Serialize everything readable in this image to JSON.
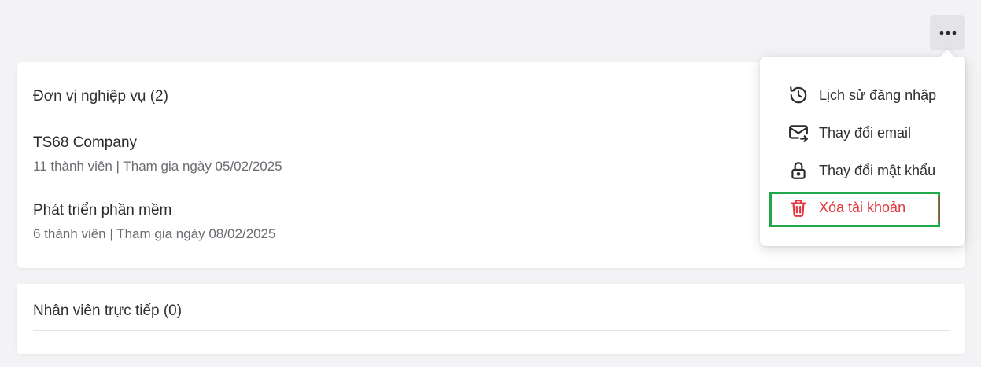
{
  "toolbar": {
    "more_icon": "more-horizontal-icon"
  },
  "units_section": {
    "title": "Đơn vị nghiệp vụ (2)",
    "items": [
      {
        "name": "TS68 Company",
        "meta": "11 thành viên | Tham gia ngày 05/02/2025"
      },
      {
        "name": "Phát triển phần mềm",
        "meta": "6 thành viên | Tham gia ngày 08/02/2025"
      }
    ]
  },
  "direct_section": {
    "title": "Nhân viên trực tiếp (0)"
  },
  "menu": {
    "items": [
      {
        "label": "Lịch sử đăng nhập",
        "icon": "history-icon"
      },
      {
        "label": "Thay đổi email",
        "icon": "mail-forward-icon"
      },
      {
        "label": "Thay đổi mật khẩu",
        "icon": "lock-icon"
      },
      {
        "label": "Xóa tài khoản",
        "icon": "trash-icon",
        "color": "#e0383e"
      }
    ]
  },
  "colors": {
    "danger": "#e0383e",
    "highlight": "#21a84a",
    "background": "#f3f3f5"
  }
}
